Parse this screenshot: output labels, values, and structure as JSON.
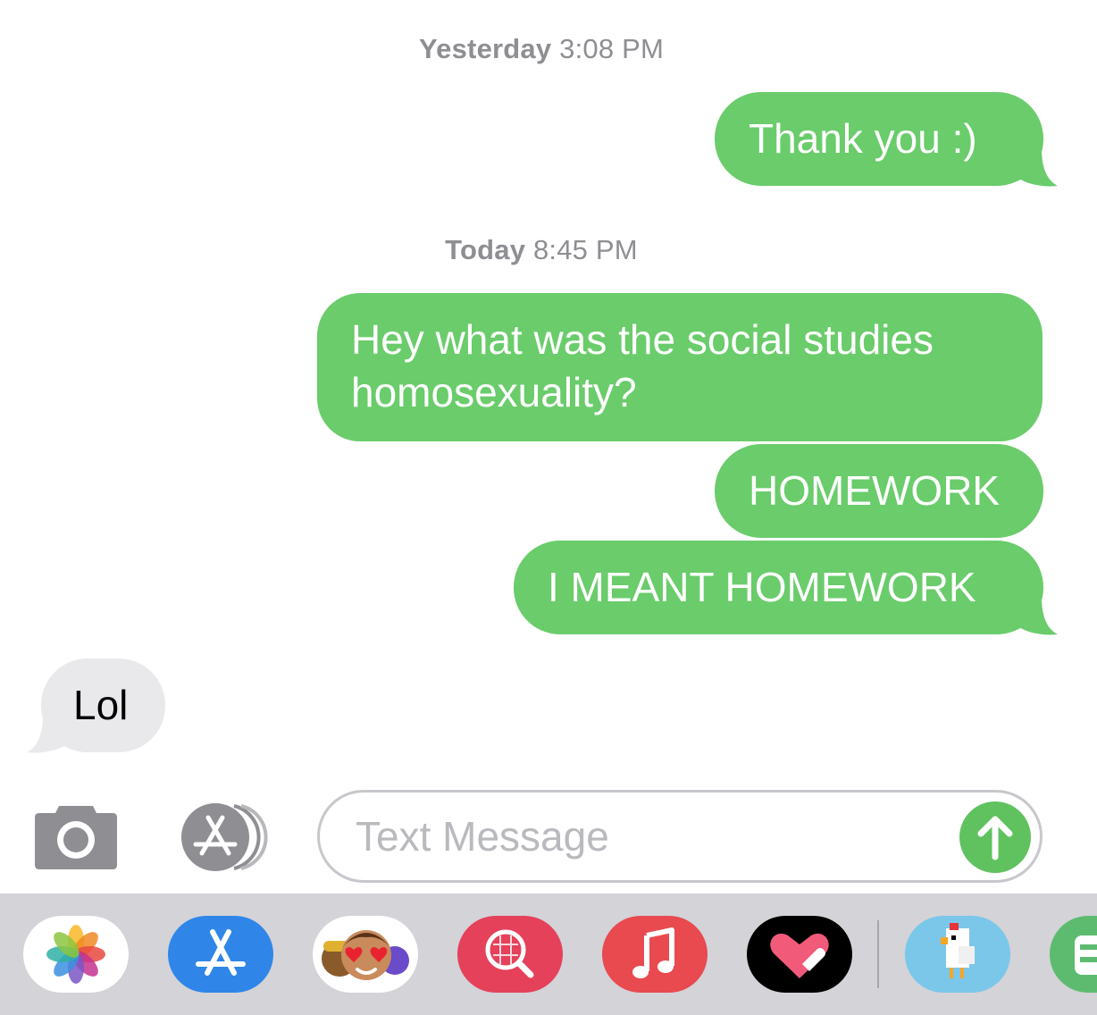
{
  "conversation": {
    "timestamps": [
      {
        "day": "Yesterday",
        "time": "3:08 PM"
      },
      {
        "day": "Today",
        "time": "8:45 PM"
      }
    ],
    "messages": [
      {
        "direction": "sent",
        "text": "Thank you :)"
      },
      {
        "direction": "sent",
        "text": "Hey what was the social studies homosexuality?"
      },
      {
        "direction": "sent",
        "text": "HOMEWORK"
      },
      {
        "direction": "sent",
        "text": "I MEANT HOMEWORK"
      },
      {
        "direction": "received",
        "text": "Lol"
      }
    ]
  },
  "input_bar": {
    "camera_icon": "camera-icon",
    "apps_icon": "app-store-icon",
    "placeholder": "Text Message",
    "send_icon": "arrow-up-icon"
  },
  "app_drawer": {
    "apps": [
      {
        "name": "Photos",
        "icon": "photos-icon"
      },
      {
        "name": "App Store",
        "icon": "app-store-icon"
      },
      {
        "name": "Memoji",
        "icon": "memoji-icon"
      },
      {
        "name": "Images Search",
        "icon": "globe-search-icon"
      },
      {
        "name": "Music",
        "icon": "music-note-icon"
      },
      {
        "name": "Digital Touch",
        "icon": "heart-touch-icon"
      },
      {
        "name": "Crossy Road",
        "icon": "chicken-icon"
      },
      {
        "name": "Partial app",
        "icon": "partial-app-icon"
      }
    ]
  },
  "colors": {
    "sent_bubble": "#6acc6b",
    "received_bubble": "#e9e9eb",
    "timestamp_text": "#8e8e93",
    "drawer_background": "#d3d3d8"
  }
}
